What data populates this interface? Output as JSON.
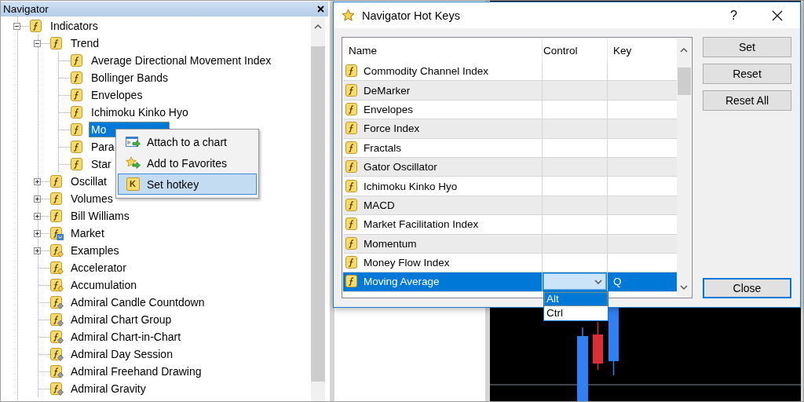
{
  "navigator": {
    "title": "Navigator",
    "tree": [
      {
        "label": "Indicators",
        "kind": "plain",
        "expanded": true,
        "selected": false,
        "children": [
          {
            "label": "Trend",
            "kind": "plain",
            "expanded": true,
            "selected": false,
            "children": [
              {
                "label": "Average Directional Movement Index",
                "kind": "plain",
                "selected": false
              },
              {
                "label": "Bollinger Bands",
                "kind": "plain",
                "selected": false
              },
              {
                "label": "Envelopes",
                "kind": "plain",
                "selected": false
              },
              {
                "label": "Ichimoku Kinko Hyo",
                "kind": "plain",
                "selected": false
              },
              {
                "label": "Mo",
                "kind": "plain",
                "selected": true
              },
              {
                "label": "Para",
                "kind": "plain",
                "selected": false
              },
              {
                "label": "Star",
                "kind": "plain",
                "selected": false
              }
            ]
          },
          {
            "label": "Oscillat",
            "kind": "plain",
            "expanded": false,
            "selected": false
          },
          {
            "label": "Volumes",
            "kind": "plain",
            "expanded": false,
            "selected": false
          },
          {
            "label": "Bill Williams",
            "kind": "plain",
            "expanded": false,
            "selected": false
          },
          {
            "label": "Market",
            "kind": "market",
            "expanded": false,
            "selected": false
          },
          {
            "label": "Examples",
            "kind": "sample",
            "expanded": false,
            "selected": false
          },
          {
            "label": "Accelerator",
            "kind": "sample",
            "selected": false
          },
          {
            "label": "Accumulation",
            "kind": "sample",
            "selected": false
          },
          {
            "label": "Admiral Candle Countdown",
            "kind": "custom",
            "selected": false
          },
          {
            "label": "Admiral Chart Group",
            "kind": "custom",
            "selected": false
          },
          {
            "label": "Admiral Chart-in-Chart",
            "kind": "custom",
            "selected": false
          },
          {
            "label": "Admiral Day Session",
            "kind": "custom",
            "selected": false
          },
          {
            "label": "Admiral Freehand Drawing",
            "kind": "custom",
            "selected": false
          },
          {
            "label": "Admiral Gravity",
            "kind": "custom",
            "selected": false
          }
        ]
      }
    ]
  },
  "context_menu": {
    "items": [
      {
        "label": "Attach to a chart",
        "kind": "attach",
        "selected": false
      },
      {
        "label": "Add to Favorites",
        "kind": "favorite",
        "selected": false
      },
      {
        "label": "Set hotkey",
        "kind": "hotkey",
        "icon_glyph": "K",
        "selected": true
      }
    ]
  },
  "dialog": {
    "title": "Navigator Hot Keys",
    "help": "?",
    "table": {
      "columns": [
        "Name",
        "Control",
        "Key"
      ],
      "rows": [
        {
          "name": "Commodity Channel Index",
          "selected": false
        },
        {
          "name": "DeMarker",
          "selected": false
        },
        {
          "name": "Envelopes",
          "selected": false
        },
        {
          "name": "Force Index",
          "selected": false
        },
        {
          "name": "Fractals",
          "selected": false
        },
        {
          "name": "Gator Oscillator",
          "selected": false
        },
        {
          "name": "Ichimoku Kinko Hyo",
          "selected": false
        },
        {
          "name": "MACD",
          "selected": false
        },
        {
          "name": "Market Facilitation Index",
          "selected": false
        },
        {
          "name": "Momentum",
          "selected": false
        },
        {
          "name": "Money Flow Index",
          "selected": false
        },
        {
          "name": "Moving Average",
          "key": "Q",
          "selected": true,
          "control_options": [
            {
              "label": "Alt",
              "selected": true
            },
            {
              "label": "Ctrl",
              "selected": false
            }
          ]
        }
      ]
    },
    "buttons": [
      {
        "label": "Set",
        "default": false
      },
      {
        "label": "Reset",
        "default": false
      },
      {
        "label": "Reset All",
        "default": false
      },
      {
        "label": "Close",
        "default": true
      }
    ]
  }
}
